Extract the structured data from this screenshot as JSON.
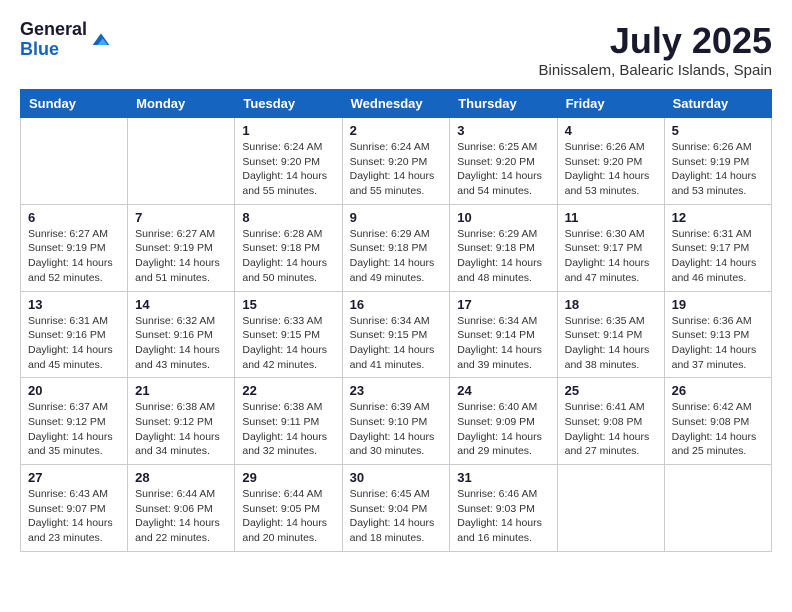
{
  "logo": {
    "general": "General",
    "blue": "Blue"
  },
  "header": {
    "month": "July 2025",
    "location": "Binissalem, Balearic Islands, Spain"
  },
  "weekdays": [
    "Sunday",
    "Monday",
    "Tuesday",
    "Wednesday",
    "Thursday",
    "Friday",
    "Saturday"
  ],
  "weeks": [
    [
      {
        "day": "",
        "sunrise": "",
        "sunset": "",
        "daylight": ""
      },
      {
        "day": "",
        "sunrise": "",
        "sunset": "",
        "daylight": ""
      },
      {
        "day": "1",
        "sunrise": "Sunrise: 6:24 AM",
        "sunset": "Sunset: 9:20 PM",
        "daylight": "Daylight: 14 hours and 55 minutes."
      },
      {
        "day": "2",
        "sunrise": "Sunrise: 6:24 AM",
        "sunset": "Sunset: 9:20 PM",
        "daylight": "Daylight: 14 hours and 55 minutes."
      },
      {
        "day": "3",
        "sunrise": "Sunrise: 6:25 AM",
        "sunset": "Sunset: 9:20 PM",
        "daylight": "Daylight: 14 hours and 54 minutes."
      },
      {
        "day": "4",
        "sunrise": "Sunrise: 6:26 AM",
        "sunset": "Sunset: 9:20 PM",
        "daylight": "Daylight: 14 hours and 53 minutes."
      },
      {
        "day": "5",
        "sunrise": "Sunrise: 6:26 AM",
        "sunset": "Sunset: 9:19 PM",
        "daylight": "Daylight: 14 hours and 53 minutes."
      }
    ],
    [
      {
        "day": "6",
        "sunrise": "Sunrise: 6:27 AM",
        "sunset": "Sunset: 9:19 PM",
        "daylight": "Daylight: 14 hours and 52 minutes."
      },
      {
        "day": "7",
        "sunrise": "Sunrise: 6:27 AM",
        "sunset": "Sunset: 9:19 PM",
        "daylight": "Daylight: 14 hours and 51 minutes."
      },
      {
        "day": "8",
        "sunrise": "Sunrise: 6:28 AM",
        "sunset": "Sunset: 9:18 PM",
        "daylight": "Daylight: 14 hours and 50 minutes."
      },
      {
        "day": "9",
        "sunrise": "Sunrise: 6:29 AM",
        "sunset": "Sunset: 9:18 PM",
        "daylight": "Daylight: 14 hours and 49 minutes."
      },
      {
        "day": "10",
        "sunrise": "Sunrise: 6:29 AM",
        "sunset": "Sunset: 9:18 PM",
        "daylight": "Daylight: 14 hours and 48 minutes."
      },
      {
        "day": "11",
        "sunrise": "Sunrise: 6:30 AM",
        "sunset": "Sunset: 9:17 PM",
        "daylight": "Daylight: 14 hours and 47 minutes."
      },
      {
        "day": "12",
        "sunrise": "Sunrise: 6:31 AM",
        "sunset": "Sunset: 9:17 PM",
        "daylight": "Daylight: 14 hours and 46 minutes."
      }
    ],
    [
      {
        "day": "13",
        "sunrise": "Sunrise: 6:31 AM",
        "sunset": "Sunset: 9:16 PM",
        "daylight": "Daylight: 14 hours and 45 minutes."
      },
      {
        "day": "14",
        "sunrise": "Sunrise: 6:32 AM",
        "sunset": "Sunset: 9:16 PM",
        "daylight": "Daylight: 14 hours and 43 minutes."
      },
      {
        "day": "15",
        "sunrise": "Sunrise: 6:33 AM",
        "sunset": "Sunset: 9:15 PM",
        "daylight": "Daylight: 14 hours and 42 minutes."
      },
      {
        "day": "16",
        "sunrise": "Sunrise: 6:34 AM",
        "sunset": "Sunset: 9:15 PM",
        "daylight": "Daylight: 14 hours and 41 minutes."
      },
      {
        "day": "17",
        "sunrise": "Sunrise: 6:34 AM",
        "sunset": "Sunset: 9:14 PM",
        "daylight": "Daylight: 14 hours and 39 minutes."
      },
      {
        "day": "18",
        "sunrise": "Sunrise: 6:35 AM",
        "sunset": "Sunset: 9:14 PM",
        "daylight": "Daylight: 14 hours and 38 minutes."
      },
      {
        "day": "19",
        "sunrise": "Sunrise: 6:36 AM",
        "sunset": "Sunset: 9:13 PM",
        "daylight": "Daylight: 14 hours and 37 minutes."
      }
    ],
    [
      {
        "day": "20",
        "sunrise": "Sunrise: 6:37 AM",
        "sunset": "Sunset: 9:12 PM",
        "daylight": "Daylight: 14 hours and 35 minutes."
      },
      {
        "day": "21",
        "sunrise": "Sunrise: 6:38 AM",
        "sunset": "Sunset: 9:12 PM",
        "daylight": "Daylight: 14 hours and 34 minutes."
      },
      {
        "day": "22",
        "sunrise": "Sunrise: 6:38 AM",
        "sunset": "Sunset: 9:11 PM",
        "daylight": "Daylight: 14 hours and 32 minutes."
      },
      {
        "day": "23",
        "sunrise": "Sunrise: 6:39 AM",
        "sunset": "Sunset: 9:10 PM",
        "daylight": "Daylight: 14 hours and 30 minutes."
      },
      {
        "day": "24",
        "sunrise": "Sunrise: 6:40 AM",
        "sunset": "Sunset: 9:09 PM",
        "daylight": "Daylight: 14 hours and 29 minutes."
      },
      {
        "day": "25",
        "sunrise": "Sunrise: 6:41 AM",
        "sunset": "Sunset: 9:08 PM",
        "daylight": "Daylight: 14 hours and 27 minutes."
      },
      {
        "day": "26",
        "sunrise": "Sunrise: 6:42 AM",
        "sunset": "Sunset: 9:08 PM",
        "daylight": "Daylight: 14 hours and 25 minutes."
      }
    ],
    [
      {
        "day": "27",
        "sunrise": "Sunrise: 6:43 AM",
        "sunset": "Sunset: 9:07 PM",
        "daylight": "Daylight: 14 hours and 23 minutes."
      },
      {
        "day": "28",
        "sunrise": "Sunrise: 6:44 AM",
        "sunset": "Sunset: 9:06 PM",
        "daylight": "Daylight: 14 hours and 22 minutes."
      },
      {
        "day": "29",
        "sunrise": "Sunrise: 6:44 AM",
        "sunset": "Sunset: 9:05 PM",
        "daylight": "Daylight: 14 hours and 20 minutes."
      },
      {
        "day": "30",
        "sunrise": "Sunrise: 6:45 AM",
        "sunset": "Sunset: 9:04 PM",
        "daylight": "Daylight: 14 hours and 18 minutes."
      },
      {
        "day": "31",
        "sunrise": "Sunrise: 6:46 AM",
        "sunset": "Sunset: 9:03 PM",
        "daylight": "Daylight: 14 hours and 16 minutes."
      },
      {
        "day": "",
        "sunrise": "",
        "sunset": "",
        "daylight": ""
      },
      {
        "day": "",
        "sunrise": "",
        "sunset": "",
        "daylight": ""
      }
    ]
  ]
}
